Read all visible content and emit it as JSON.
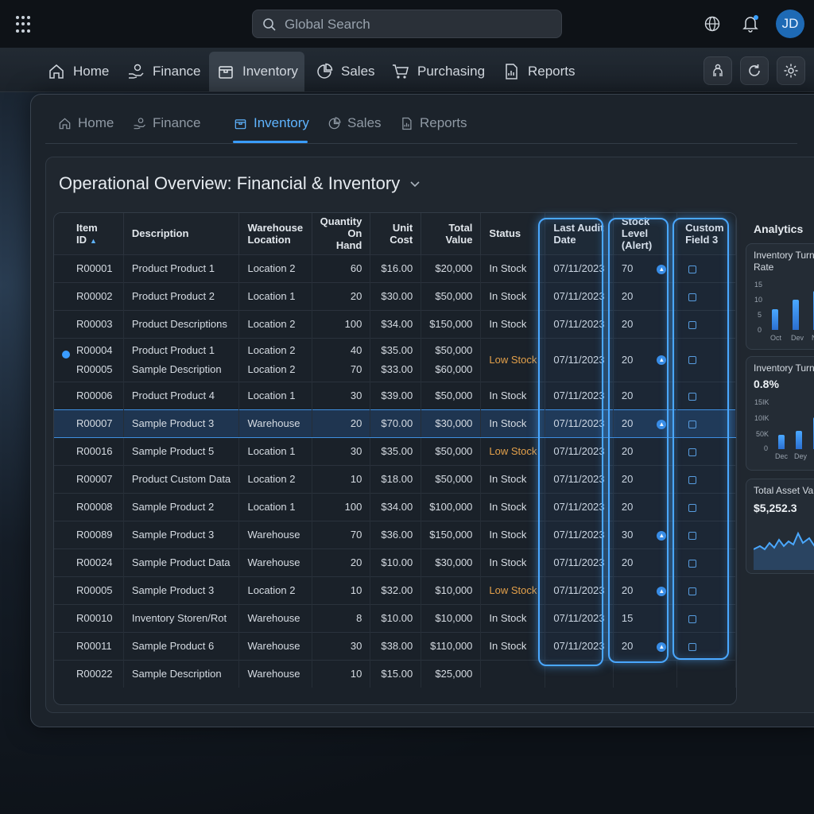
{
  "search": {
    "placeholder": "Global Search"
  },
  "user": {
    "initials": "JD"
  },
  "mainnav": [
    {
      "label": "Home",
      "icon": "home-icon"
    },
    {
      "label": "Finance",
      "icon": "finance-icon"
    },
    {
      "label": "Inventory",
      "icon": "box-icon",
      "active": true
    },
    {
      "label": "Sales",
      "icon": "pie-icon"
    },
    {
      "label": "Purchasing",
      "icon": "cart-icon"
    },
    {
      "label": "Reports",
      "icon": "report-icon"
    }
  ],
  "subnav": [
    {
      "label": "Home"
    },
    {
      "label": "Finance"
    },
    {
      "label": "Inventory",
      "active": true
    },
    {
      "label": "Sales"
    },
    {
      "label": "Reports"
    }
  ],
  "page": {
    "title": "Operational Overview: Financial & Inventory"
  },
  "table": {
    "headers": [
      "Item ID",
      "Description",
      "Warehouse Location",
      "Quantity On Hand",
      "Unit Cost",
      "Total Value",
      "Status",
      "Last Audit Date",
      "Stock Level (Alert)",
      "Custom Field 3"
    ],
    "rows": [
      {
        "id": "R00001",
        "desc": "Product Product 1",
        "loc": "Location 2",
        "qty": "60",
        "cost": "$16.00",
        "total": "$20,000",
        "status": "In Stock",
        "date": "07/11/2023",
        "stock": "70",
        "alert": true
      },
      {
        "id": "R00002",
        "desc": "Product Product 2",
        "loc": "Location 1",
        "qty": "20",
        "cost": "$30.00",
        "total": "$50,000",
        "status": "In Stock",
        "date": "07/11/2023",
        "stock": "20",
        "alert": false
      },
      {
        "id": "R00003",
        "desc": "Product Descriptions",
        "loc": "Location 2",
        "qty": "100",
        "cost": "$34.00",
        "total": "$150,000",
        "status": "In Stock",
        "date": "07/11/2023",
        "stock": "20",
        "alert": false
      },
      {
        "id": "R00004",
        "id2": "R00005",
        "desc": "Product Product 1",
        "desc2": "Sample  Description",
        "loc": "Location 2",
        "loc2": "Location 2",
        "qty": "40",
        "qty2": "70",
        "cost": "$35.00",
        "cost2": "$33.00",
        "total": "$50,000",
        "total2": "$60,000",
        "status": "Low Stock",
        "date": "07/11/2023",
        "stock": "20",
        "alert": true
      },
      {
        "id": "R00006",
        "desc": "Product Product 4",
        "loc": "Location 1",
        "qty": "30",
        "cost": "$39.00",
        "total": "$50,000",
        "status": "In Stock",
        "date": "07/11/2023",
        "stock": "20",
        "alert": false
      },
      {
        "id": "R00007",
        "desc": "Sample Product 3",
        "loc": "Warehouse",
        "qty": "20",
        "cost": "$70.00",
        "total": "$30,000",
        "status": "In Stock",
        "date": "07/11/2023",
        "stock": "20",
        "alert": true,
        "selected": true
      },
      {
        "id": "R00016",
        "desc": "Sample Product 5",
        "loc": "Location 1",
        "qty": "30",
        "cost": "$35.00",
        "total": "$50,000",
        "status": "Low Stock",
        "date": "07/11/2023",
        "stock": "20",
        "alert": false
      },
      {
        "id": "R00007",
        "desc": "Product Custom Data",
        "loc": "Location 2",
        "qty": "10",
        "cost": "$18.00",
        "total": "$50,000",
        "status": "In Stock",
        "date": "07/11/2023",
        "stock": "20",
        "alert": false
      },
      {
        "id": "R00008",
        "desc": "Sample Product 2",
        "loc": "Location 1",
        "qty": "100",
        "cost": "$34.00",
        "total": "$100,000",
        "status": "In Stock",
        "date": "07/11/2023",
        "stock": "20",
        "alert": false
      },
      {
        "id": "R00089",
        "desc": "Sample Product 3",
        "loc": "Warehouse",
        "qty": "70",
        "cost": "$36.00",
        "total": "$150,000",
        "status": "In Stock",
        "date": "07/11/2023",
        "stock": "30",
        "alert": true
      },
      {
        "id": "R00024",
        "desc": "Sample Product Data",
        "loc": "Warehouse",
        "qty": "20",
        "cost": "$10.00",
        "total": "$30,000",
        "status": "In Stock",
        "date": "07/11/2023",
        "stock": "20",
        "alert": false
      },
      {
        "id": "R00005",
        "desc": "Sample Product 3",
        "loc": "Location 2",
        "qty": "10",
        "cost": "$32.00",
        "total": "$10,000",
        "status": "Low Stock",
        "date": "07/11/2023",
        "stock": "20",
        "alert": true
      },
      {
        "id": "R00010",
        "desc": "Inventory Storen/Rot",
        "loc": "Warehouse",
        "qty": "8",
        "cost": "$10.00",
        "total": "$10,000",
        "status": "In Stock",
        "date": "07/11/2023",
        "stock": "15",
        "alert": false
      },
      {
        "id": "R00011",
        "desc": "Sample Product 6",
        "loc": "Warehouse",
        "qty": "30",
        "cost": "$38.00",
        "total": "$110,000",
        "status": "In Stock",
        "date": "07/11/2023",
        "stock": "20",
        "alert": true
      },
      {
        "id": "R00022",
        "desc": "Sample Description",
        "loc": "Warehouse",
        "qty": "10",
        "cost": "$15.00",
        "total": "$25,000",
        "status": "",
        "date": "",
        "stock": "",
        "alert": false
      }
    ]
  },
  "analytics": {
    "title": "Analytics",
    "turnover_rate": {
      "title": "Inventory Turn Rate",
      "yticks": [
        "15",
        "10",
        "5",
        "0"
      ],
      "xticks": [
        "Oct",
        "Dev",
        "N"
      ],
      "values": [
        0.45,
        0.65,
        0.85
      ]
    },
    "turnover": {
      "title": "Inventory Turn",
      "value": "0.8%",
      "yticks": [
        "15IK",
        "10IK",
        "50K",
        "0"
      ],
      "xticks": [
        "Dec",
        "Dey"
      ],
      "values": [
        0.35,
        0.45,
        0.8
      ]
    },
    "asset": {
      "title": "Total Asset Va",
      "value": "$5,252.3"
    }
  },
  "colors": {
    "accent": "#3a9cff",
    "low_stock": "#e3a04a",
    "background": "#151d27"
  }
}
